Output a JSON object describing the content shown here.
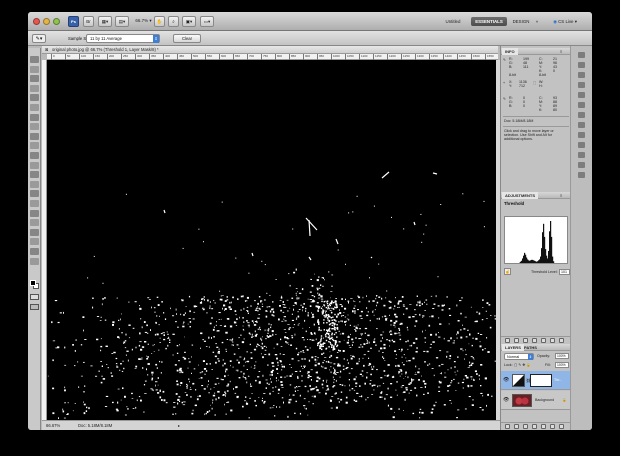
{
  "app": {
    "zoom_label": "66.7",
    "zoom_unit": "%",
    "workspace_current": "ESSENTIALS",
    "workspace_buttons": [
      "DESIGN",
      "»"
    ],
    "workspace_left": "Untitled",
    "cs_live": "CS Live"
  },
  "options_bar": {
    "sample_size_label": "Sample Size:",
    "sample_size_value": "11 by 11 Average",
    "clear_button": "Clear"
  },
  "document": {
    "tab_title": "original photo.jpg @ 66.7% (Threshold 1, Layer Mask/8) *",
    "ruler_ticks": [
      "0",
      "50",
      "100",
      "150",
      "200",
      "250",
      "300",
      "350",
      "400",
      "450",
      "500",
      "550",
      "600",
      "650",
      "700",
      "750",
      "800",
      "850",
      "900",
      "950",
      "1000",
      "1050",
      "1100",
      "1150",
      "1200",
      "1250",
      "1300",
      "1350",
      "1400",
      "1450",
      "1500",
      "1550",
      "1600"
    ],
    "status_zoom": "66.67%",
    "status_doc": "Doc: 5.18M/8.18M"
  },
  "info_panel": {
    "tab_label": "INFO",
    "r1": [
      "R:",
      "G:",
      "B:"
    ],
    "r1_vals": [
      "199",
      "48",
      "111"
    ],
    "k1": [
      "C:",
      "M:",
      "Y:",
      "K:"
    ],
    "k1_vals": [
      "21",
      "96",
      "43",
      "0"
    ],
    "bit_left": "8-bit",
    "bit_right": "8-bit",
    "xy_label": [
      "X:",
      "Y:"
    ],
    "xy_vals": [
      "1136",
      "712"
    ],
    "wh_label": [
      "W:",
      "H:"
    ],
    "wh_vals": [
      "",
      ""
    ],
    "r2": [
      "R:",
      "G:",
      "B:"
    ],
    "r2_vals": [
      "0",
      "0",
      "0"
    ],
    "k2": [
      "C:",
      "M:",
      "Y:",
      "K:"
    ],
    "k2_vals": [
      "93",
      "88",
      "89",
      "80"
    ],
    "doc": "Doc: 5.18M/8.18M",
    "help": "Click and drag to move layer or selection. Use Shift and Alt for additional options."
  },
  "adjustments": {
    "tab_label": "ADJUSTMENTS",
    "title": "Threshold",
    "level_label": "Threshold Level:",
    "level_value": "101",
    "histogram": [
      0,
      0,
      0,
      0,
      0,
      0,
      1,
      1,
      1,
      2,
      2,
      3,
      3,
      4,
      5,
      7,
      9,
      14,
      20,
      26,
      22,
      16,
      12,
      10,
      9,
      10,
      11,
      11,
      10,
      9,
      8,
      7,
      8,
      10,
      12,
      18,
      36,
      70,
      88,
      60,
      34,
      20,
      14,
      30,
      72,
      94,
      60,
      18,
      8,
      4,
      2,
      1,
      1,
      0,
      0,
      0,
      0,
      0,
      0,
      0,
      0,
      0,
      0,
      0
    ]
  },
  "layers": {
    "tabs": [
      "LAYERS",
      "PATHS"
    ],
    "blend_mode": "Normal",
    "opacity_label": "Opacity:",
    "opacity_value": "100%",
    "lock_label": "Lock:",
    "fill_label": "Fill:",
    "fill_value": "100%",
    "items": [
      {
        "name": "Thr..."
      },
      {
        "name": "Background"
      }
    ]
  },
  "colors": {
    "accent_blue": "#3d7fd8",
    "selected_layer": "#8fb6e6",
    "panel_bg": "#c2c2c2"
  }
}
